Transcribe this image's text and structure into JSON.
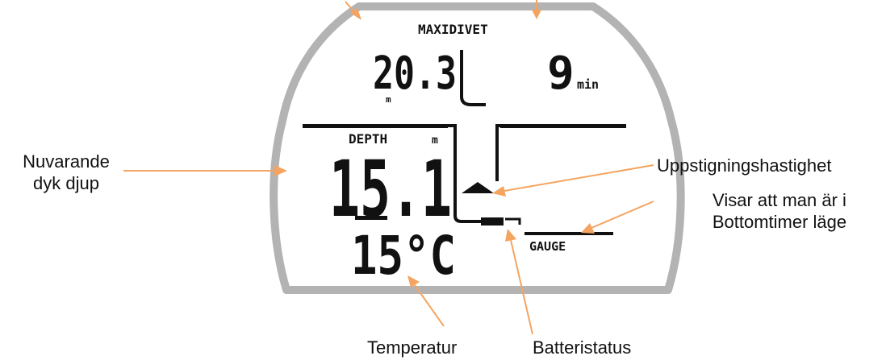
{
  "display": {
    "maxdive_label": "MAXIDIVET",
    "max_depth": "20.3",
    "max_depth_unit": "m",
    "dive_time": "9",
    "dive_time_unit": "min",
    "depth_label": "DEPTH",
    "depth_unit": "m",
    "current_depth": "15.1",
    "temperature": "15°C",
    "mode_label": "GAUGE"
  },
  "annotations": {
    "current_depth": [
      "Nuvarande",
      "dyk djup"
    ],
    "ascent_rate": "Uppstigningshastighet",
    "mode": [
      "Visar att man är i",
      "Bottomtimer läge"
    ],
    "temperature": "Temperatur",
    "battery": "Batteristatus"
  },
  "colors": {
    "arrow": "#F4A460",
    "bezel": "#B3B3B3",
    "lcd_segments": "#111111"
  }
}
